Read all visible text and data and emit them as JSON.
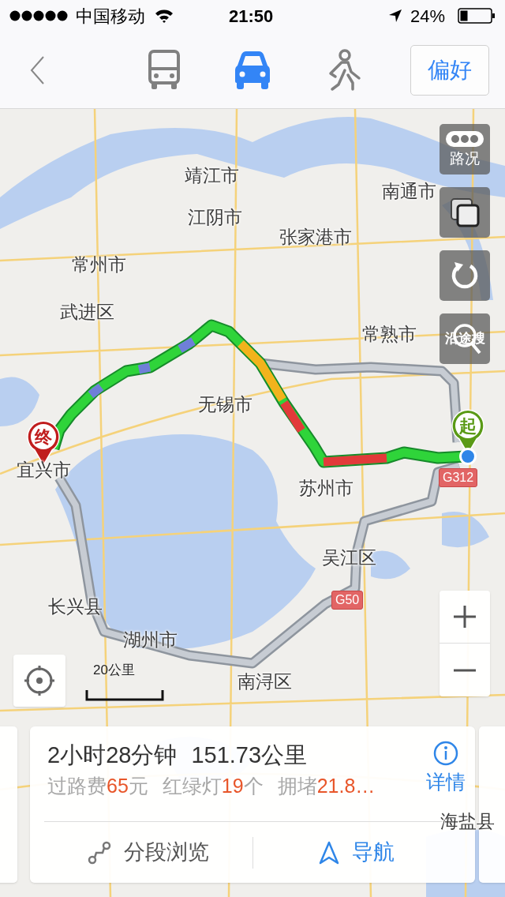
{
  "status_bar": {
    "carrier": "中国移动",
    "time": "21:50",
    "battery": "24%"
  },
  "nav": {
    "modes": [
      {
        "kind": "bus",
        "selected": false
      },
      {
        "kind": "car",
        "selected": true
      },
      {
        "kind": "walk",
        "selected": false
      }
    ],
    "preference_button": "偏好"
  },
  "map": {
    "labels": [
      "靖江市",
      "江阴市",
      "张家港市",
      "南通市",
      "常州市",
      "武进区",
      "常熟市",
      "无锡市",
      "宜兴市",
      "苏州市",
      "吴江区",
      "长兴县",
      "湖州市",
      "南浔区",
      "海盐县"
    ],
    "road_shields": [
      "G312",
      "G50"
    ],
    "start_marker": "起",
    "end_marker": "终",
    "scale": "20公里",
    "side_controls": [
      {
        "kind": "traffic",
        "label": "路况"
      },
      {
        "kind": "layers"
      },
      {
        "kind": "refresh"
      },
      {
        "kind": "search_along",
        "label": "沿途搜"
      }
    ]
  },
  "route_card": {
    "duration": "2小时28分钟",
    "distance": "151.73公里",
    "stats": [
      {
        "label": "过路费",
        "value": "65",
        "unit": "元"
      },
      {
        "label": "红绿灯",
        "value": "19",
        "unit": "个"
      },
      {
        "label": "拥堵",
        "value": "21.8…"
      }
    ],
    "details": "详情",
    "actions": [
      {
        "kind": "segments",
        "label": "分段浏览"
      },
      {
        "kind": "navigate",
        "label": "导航"
      }
    ]
  }
}
